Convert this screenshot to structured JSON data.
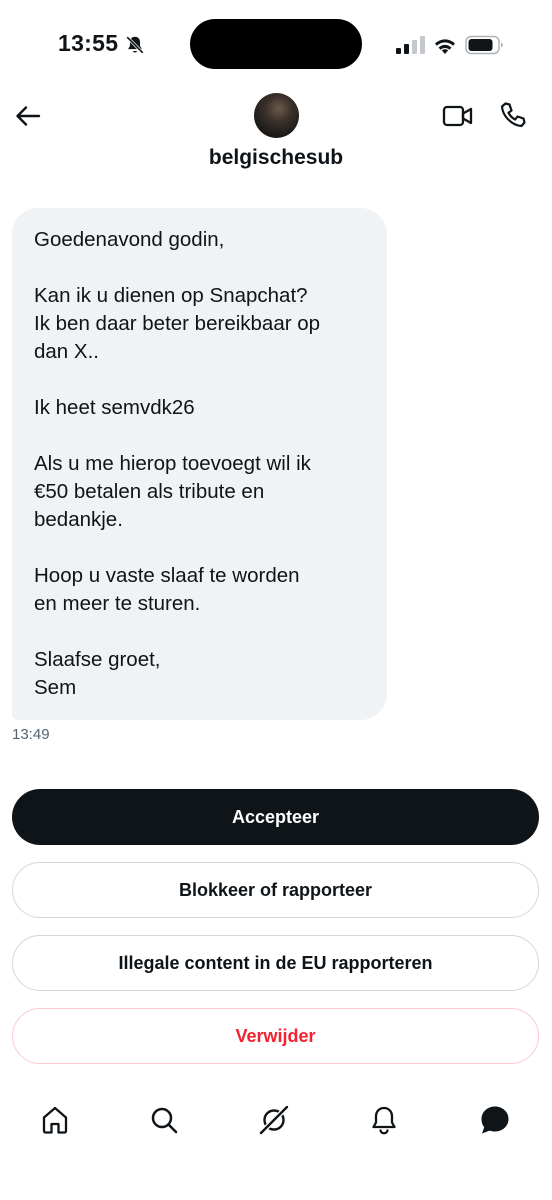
{
  "status_bar": {
    "time": "13:55",
    "icons": [
      "bell-slash-icon",
      "cellular-signal-icon",
      "wifi-icon",
      "battery-icon"
    ]
  },
  "header": {
    "username": "belgischesub",
    "icons": [
      "back-arrow-icon",
      "video-call-icon",
      "phone-call-icon"
    ]
  },
  "message": {
    "paragraphs": [
      "Goedenavond godin,",
      "Kan ik u dienen op Snapchat?\nIk ben daar beter bereikbaar op\ndan X..",
      "Ik heet semvdk26",
      "Als u me hierop toevoegt wil ik\n€50 betalen als tribute en\nbedankje.",
      "Hoop u vaste slaaf te worden\nen meer te sturen.",
      "Slaafse groet,\nSem"
    ],
    "time": "13:49"
  },
  "actions": {
    "accept": "Accepteer",
    "block_report": "Blokkeer of rapporteer",
    "eu_report": "Illegale content in de EU rapporteren",
    "delete": "Verwijder"
  },
  "colors": {
    "text": "#0f1419",
    "bubble": "#eff3f4",
    "muted": "#536471",
    "danger": "#f4212e",
    "border": "#cfd9de"
  },
  "bottom_nav": {
    "items": [
      "home-icon",
      "search-icon",
      "grok-icon",
      "notifications-icon",
      "messages-icon"
    ],
    "active": "messages-icon"
  }
}
